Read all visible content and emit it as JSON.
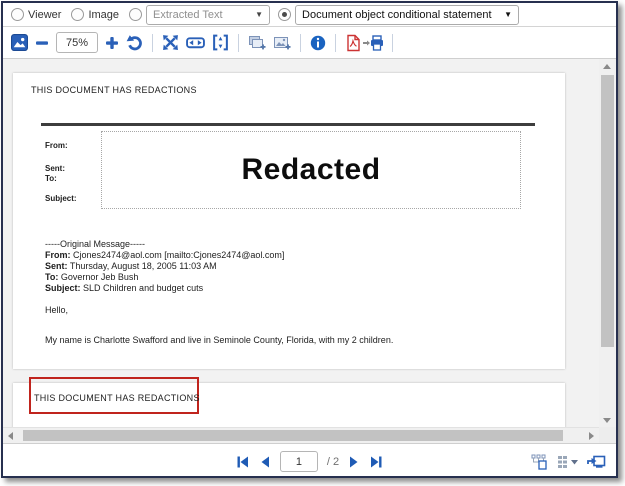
{
  "colors": {
    "accent_blue": "#2a60b8",
    "icon_gray_blue": "#7d93b8",
    "annotation_red": "#c0241d",
    "window_border": "#27304f",
    "pdf_red": "#cc3333"
  },
  "top_bar": {
    "viewer_radio": {
      "label": "Viewer",
      "selected": false
    },
    "image_radio": {
      "label": "Image",
      "selected": false
    },
    "extracted_text_dropdown": {
      "value": "Extracted Text",
      "radio_selected": false,
      "caret": "▼"
    },
    "conditional_dropdown": {
      "value": "Document object conditional statement",
      "radio_selected": true,
      "caret": "▼"
    }
  },
  "toolbar": {
    "zoom_value": "75%",
    "icons": [
      "image-viewer-mode",
      "zoom-out",
      "zoom-in",
      "rotate-left",
      "actual-size",
      "fit-width",
      "fit-page",
      "copy-page-add",
      "copy-image-add",
      "info",
      "save-pdf-to-printer"
    ]
  },
  "document": {
    "page1": {
      "redaction_notice": "THIS DOCUMENT HAS REDACTIONS",
      "envelope_labels": [
        "From:",
        "Sent:",
        "To:",
        "Subject:"
      ],
      "redacted_label": "Redacted",
      "email": {
        "header": "-----Original Message-----",
        "fields": [
          {
            "label": "From:",
            "value": "Cjones2474@aol.com [mailto:Cjones2474@aol.com]"
          },
          {
            "label": "Sent:",
            "value": "Thursday, August 18, 2005 11:03 AM"
          },
          {
            "label": "To:",
            "value": "Governor Jeb Bush"
          },
          {
            "label": "Subject:",
            "value": "SLD Children and budget cuts"
          }
        ],
        "greeting": "Hello,",
        "body": "My name is Charlotte Swafford and live in Seminole County, Florida, with my 2 children."
      }
    },
    "page2": {
      "redaction_notice": "THIS DOCUMENT HAS REDACTIONS",
      "annotation": "red-rectangle-highlight"
    }
  },
  "pagination": {
    "current_page": "1",
    "total_pages_label": "/ 2",
    "nav_icons": [
      "first-page",
      "previous-page",
      "next-page",
      "last-page"
    ],
    "right_icons": [
      "related-documents",
      "grid-options",
      "pop-out-viewer"
    ]
  }
}
